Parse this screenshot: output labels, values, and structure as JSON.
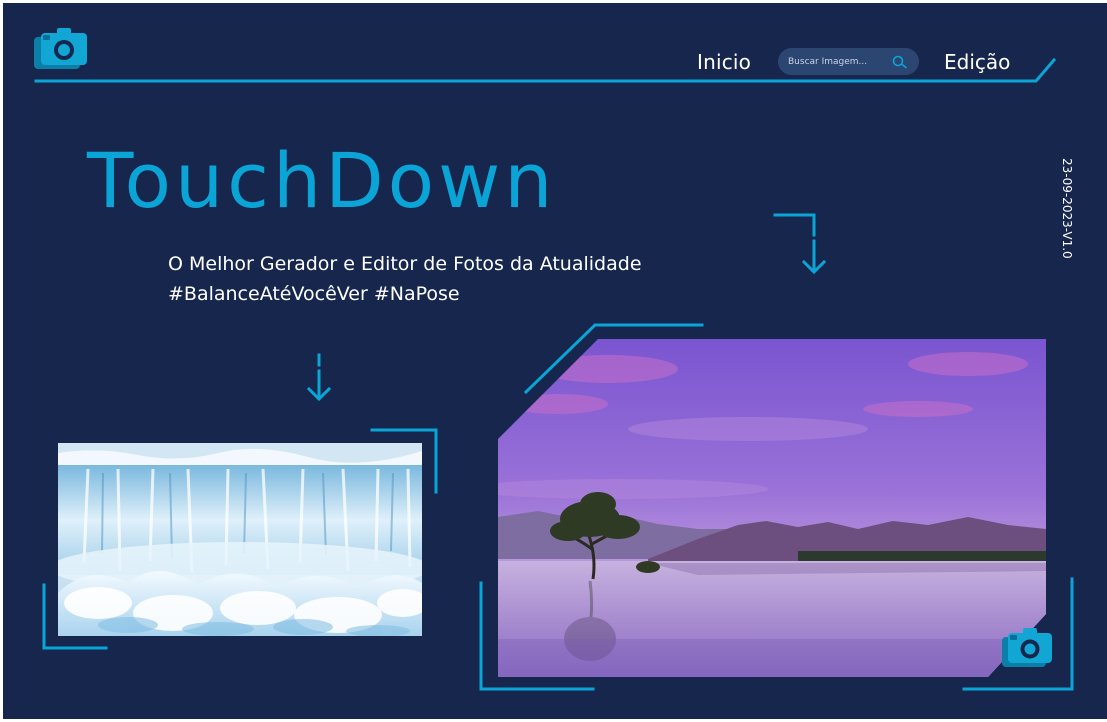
{
  "header": {
    "nav": {
      "home_label": "Inicio",
      "edit_label": "Edição"
    },
    "search": {
      "placeholder": "Buscar Imagem..."
    }
  },
  "hero": {
    "title": "TouchDown",
    "subtitle": "O Melhor Gerador e Editor de Fotos da Atualidade",
    "hashtags": "#BalanceAtéVocêVer #NaPose"
  },
  "version": "23-09-2023-V1.0",
  "colors": {
    "background": "#16264d",
    "accent": "#0aa5d6",
    "search_bg": "#2c4672",
    "text": "#ffffff"
  },
  "icons": {
    "logo": "camera-icon",
    "search": "search-icon",
    "corner": "camera-icon"
  },
  "images": {
    "left": "frozen-waterfall",
    "right": "lake-tree-sunset"
  }
}
